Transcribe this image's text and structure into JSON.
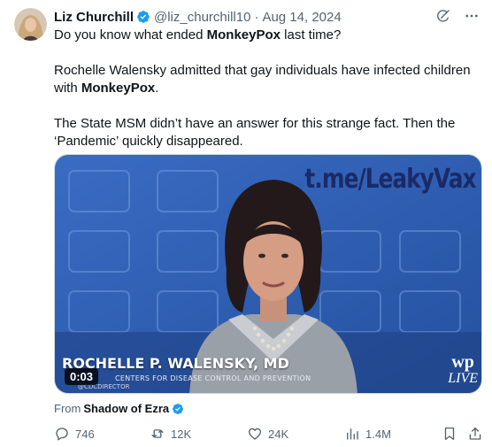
{
  "author": {
    "name": "Liz Churchill",
    "handle": "@liz_churchill10",
    "separator": "·",
    "date": "Aug 14, 2024",
    "verified": true,
    "verified_color": "#1d9bf0"
  },
  "tweet": {
    "paragraph1": {
      "pre": "Do you know what ended ",
      "bold": "MonkeyPox",
      "post": " last time?"
    },
    "paragraph2": {
      "pre": "Rochelle Walensky admitted that gay individuals have infected children with ",
      "bold": "MonkeyPox",
      "post": "."
    },
    "paragraph3": "The State MSM didn’t have an answer for this strange fact. Then the ‘Pandemic’ quickly disappeared."
  },
  "media": {
    "watermark": "t.me/LeakyVax",
    "lower_third_name": "ROCHELLE P. WALENSKY, MD",
    "lower_third_org": "CENTERS FOR DISEASE CONTROL AND PREVENTION",
    "lower_third_sub": "@CDCDIRECTOR",
    "duration": "0:03",
    "wp_logo": "wp",
    "live_label": "LIVE"
  },
  "attribution": {
    "prefix": "From",
    "source": "Shadow of Ezra",
    "verified": true
  },
  "actions": {
    "replies": "746",
    "reposts": "12K",
    "likes": "24K",
    "views": "1.4M"
  },
  "icons": {
    "top_right": [
      "grok-icon",
      "more-icon"
    ],
    "action_bar": [
      "reply-icon",
      "repost-icon",
      "like-icon",
      "views-icon",
      "bookmark-icon",
      "share-icon"
    ]
  },
  "colors": {
    "text_primary": "#0f1419",
    "text_secondary": "#536471",
    "accent": "#1d9bf0",
    "media_background": "#2f5fb8"
  }
}
